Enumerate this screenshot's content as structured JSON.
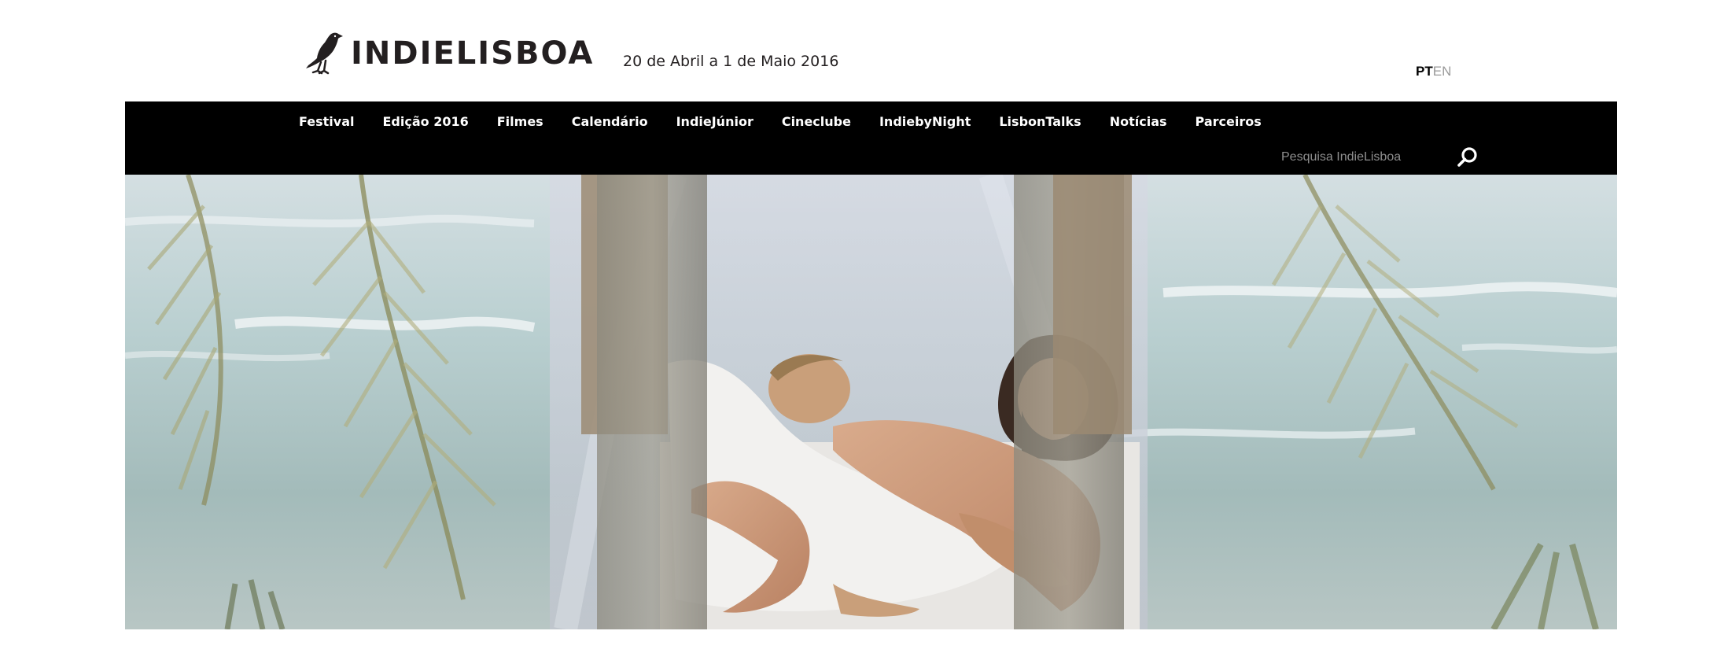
{
  "header": {
    "logo_text": "INDIELISBOA",
    "dates": "20 de Abril a 1 de Maio 2016",
    "lang_pt": "PT",
    "lang_en": "EN"
  },
  "nav": {
    "items": [
      {
        "label": "Festival"
      },
      {
        "label": "Edição 2016"
      },
      {
        "label": "Filmes"
      },
      {
        "label": "Calendário"
      },
      {
        "label": "IndieJúnior"
      },
      {
        "label": "Cineclube"
      },
      {
        "label": "IndiebyNight"
      },
      {
        "label": "LisbonTalks"
      },
      {
        "label": "Notícias"
      },
      {
        "label": "Parceiros"
      }
    ]
  },
  "search": {
    "placeholder": "Pesquisa IndieLisboa",
    "value": ""
  },
  "icons": {
    "logo": "bird-logo-icon",
    "search": "search-icon"
  },
  "colors": {
    "nav_background": "#000000",
    "text_dark": "#231f20",
    "lang_inactive": "#9a9a9a"
  }
}
